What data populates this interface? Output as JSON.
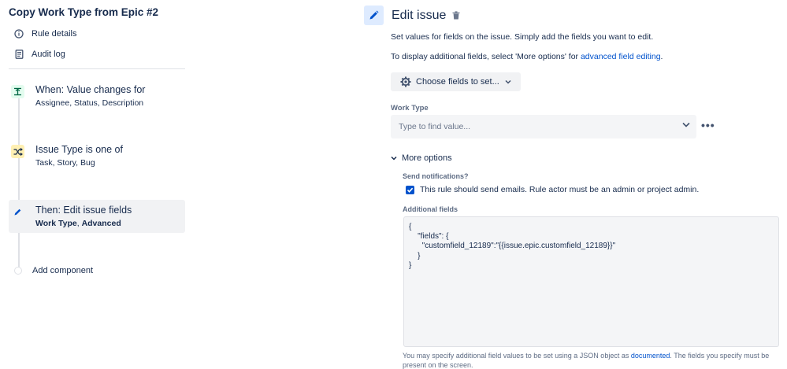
{
  "rule": {
    "title": "Copy Work Type from Epic #2",
    "nav": [
      {
        "label": "Rule details",
        "icon": "info-icon"
      },
      {
        "label": "Audit log",
        "icon": "document-icon"
      }
    ]
  },
  "steps": {
    "trigger": {
      "title": "When: Value changes for",
      "subtitle": "Assignee, Status, Description",
      "icon": "trigger-icon",
      "color": "#e3fcef"
    },
    "condition": {
      "title": "Issue Type is one of",
      "subtitle": "Task, Story, Bug",
      "icon": "shuffle-icon",
      "color": "#fff0b3"
    },
    "action": {
      "title": "Then: Edit issue fields",
      "subtitle_part1": "Work Type",
      "subtitle_sep": ", ",
      "subtitle_part2": "Advanced",
      "icon": "pencil-icon"
    },
    "add_component": "Add component"
  },
  "editor": {
    "title": "Edit issue",
    "desc1": "Set values for fields on the issue. Simply add the fields you want to edit.",
    "desc2_prefix": "To display additional fields, select 'More options' for ",
    "desc2_link": "advanced field editing",
    "desc2_suffix": ".",
    "choose_fields_label": "Choose fields to set...",
    "work_type_label": "Work Type",
    "work_type_placeholder": "Type to find value...",
    "more_dots": "•••",
    "more_options_label": "More options",
    "send_notifications_label": "Send notifications?",
    "send_notifications_text": "This rule should send emails. Rule actor must be an admin or project admin.",
    "send_notifications_checked": true,
    "additional_fields_label": "Additional fields",
    "additional_fields_value": "{\n    \"fields\": {\n      \"customfield_12189\":\"{{issue.epic.customfield_12189}}\"\n    }\n}",
    "help_prefix": "You may specify additional field values to be set using a JSON object as ",
    "help_link": "documented",
    "help_suffix": ". The fields you specify must be present on the screen."
  },
  "colors": {
    "accent": "#0052cc",
    "selected_bg": "#f1f2f4"
  }
}
